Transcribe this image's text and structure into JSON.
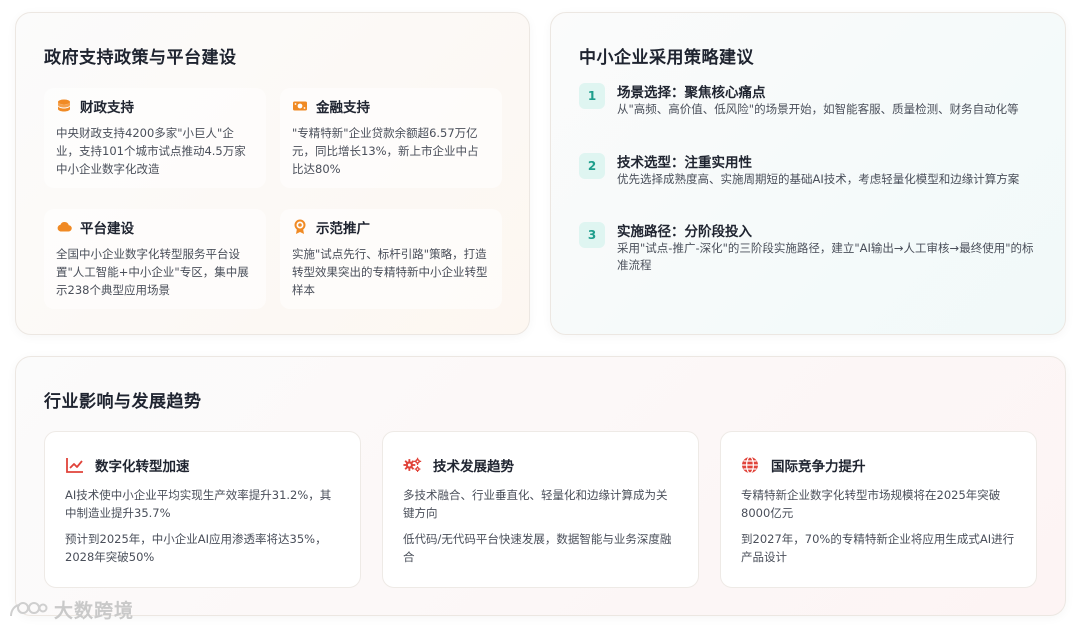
{
  "government": {
    "title": "政府支持政策与平台建设",
    "items": [
      {
        "icon": "coins-icon",
        "title": "财政支持",
        "text": "中央财政支持4200多家\"小巨人\"企业，支持101个城市试点推动4.5万家中小企业数字化改造"
      },
      {
        "icon": "money-bill-icon",
        "title": "金融支持",
        "text": "\"专精特新\"企业贷款余额超6.57万亿元，同比增长13%，新上市企业中占比达80%"
      },
      {
        "icon": "cloud-icon",
        "title": "平台建设",
        "text": "全国中小企业数字化转型服务平台设置\"人工智能+中小企业\"专区，集中展示238个典型应用场景"
      },
      {
        "icon": "award-icon",
        "title": "示范推广",
        "text": "实施\"试点先行、标杆引路\"策略，打造转型效果突出的专精特新中小企业转型样本"
      }
    ]
  },
  "sme": {
    "title": "中小企业采用策略建议",
    "items": [
      {
        "num": "1",
        "title": "场景选择：聚焦核心痛点",
        "text": "从\"高频、高价值、低风险\"的场景开始，如智能客服、质量检测、财务自动化等"
      },
      {
        "num": "2",
        "title": "技术选型：注重实用性",
        "text": "优先选择成熟度高、实施周期短的基础AI技术，考虑轻量化模型和边缘计算方案"
      },
      {
        "num": "3",
        "title": "实施路径：分阶段投入",
        "text": "采用\"试点-推广-深化\"的三阶段实施路径，建立\"AI输出→人工审核→最终使用\"的标准流程"
      }
    ]
  },
  "industry": {
    "title": "行业影响与发展趋势",
    "items": [
      {
        "icon": "line-chart-icon",
        "title": "数字化转型加速",
        "paragraphs": [
          "AI技术使中小企业平均实现生产效率提升31.2%，其中制造业提升35.7%",
          "预计到2025年，中小企业AI应用渗透率将达35%，2028年突破50%"
        ]
      },
      {
        "icon": "gears-icon",
        "title": "技术发展趋势",
        "paragraphs": [
          "多技术融合、行业垂直化、轻量化和边缘计算成为关键方向",
          "低代码/无代码平台快速发展，数据智能与业务深度融合"
        ]
      },
      {
        "icon": "globe-icon",
        "title": "国际竞争力提升",
        "paragraphs": [
          "专精特新企业数字化转型市场规模将在2025年突破8000亿元",
          "到2027年，70%的专精特新企业将应用生成式AI进行产品设计"
        ]
      }
    ]
  },
  "watermark": {
    "text": "大数跨境",
    "icon": "logo-icon"
  },
  "colors": {
    "accent_orange": "#f08a24",
    "accent_teal": "#1e9e8c",
    "accent_red": "#e0433a",
    "badge_bg": "#dff5f1"
  }
}
